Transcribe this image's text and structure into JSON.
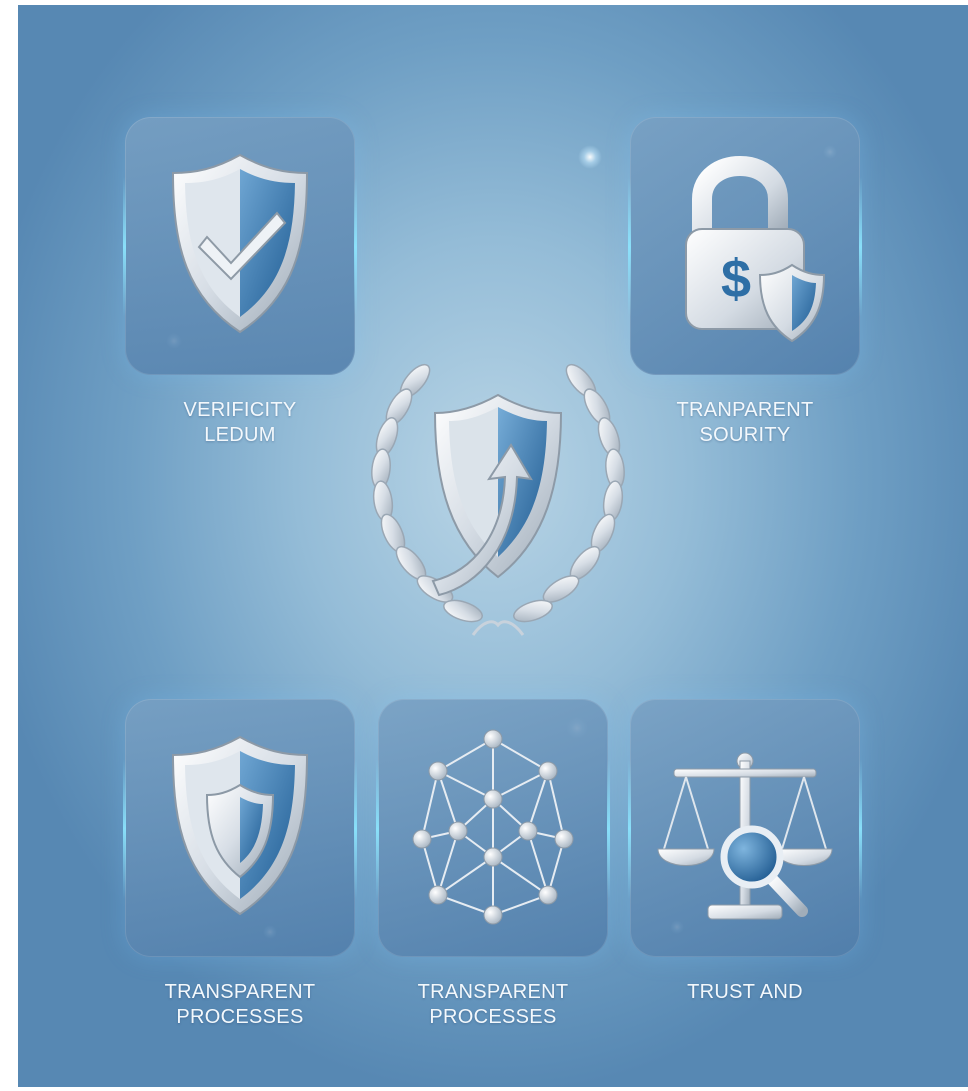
{
  "tiles": [
    {
      "id": "verified",
      "icon": "shield-check-icon",
      "label_lines": [
        "VERIFICITY",
        "LEDUM"
      ]
    },
    {
      "id": "security",
      "icon": "padlock-dollar-icon",
      "label_lines": [
        "TRANPARENT",
        "SOURITY"
      ]
    },
    {
      "id": "processes-1",
      "icon": "shield-layered-icon",
      "label_lines": [
        "TRANSPARENT",
        "PROCESSES"
      ]
    },
    {
      "id": "processes-2",
      "icon": "network-cube-icon",
      "label_lines": [
        "TRANSPARENT",
        "PROCESSES"
      ]
    },
    {
      "id": "trust",
      "icon": "scales-magnifier-icon",
      "label_lines": [
        "TRUST AND"
      ]
    }
  ],
  "center_emblem": {
    "icon": "shield-arrow-laurel-icon"
  },
  "colors": {
    "background_center": "#b9d5e6",
    "background_edge": "#5788b3",
    "shield_blue": "#2e6fa6",
    "silver": "#e9eef3",
    "label_text": "#f3f8fc"
  }
}
